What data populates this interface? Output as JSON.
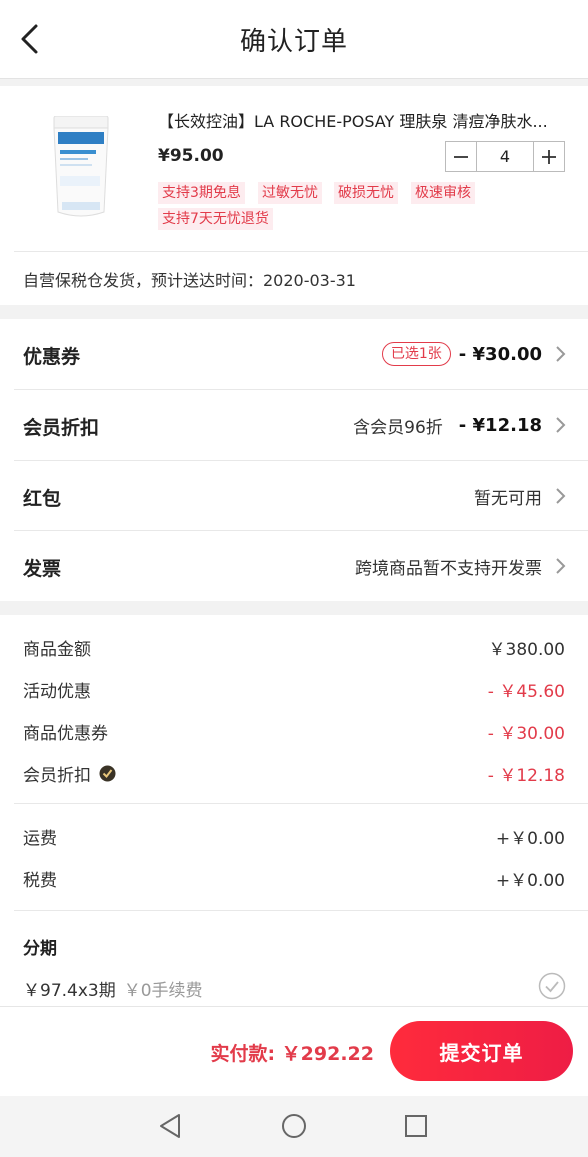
{
  "header": {
    "title": "确认订单"
  },
  "product": {
    "title": "【长效控油】LA ROCHE-POSAY 理肤泉 清痘净肤水...",
    "price": "¥95.00",
    "quantity": "4",
    "tags": [
      "支持3期免息",
      "过敏无忧",
      "破损无忧",
      "极速审核",
      "支持7天无忧退货"
    ],
    "shipping": "自营保税仓发货，预计送达时间：2020-03-31"
  },
  "options": {
    "coupon": {
      "label": "优惠券",
      "badge": "已选1张",
      "amount": "- ¥30.00"
    },
    "member": {
      "label": "会员折扣",
      "note": "含会员96折",
      "amount": "- ¥12.18"
    },
    "redpacket": {
      "label": "红包",
      "value": "暂无可用"
    },
    "invoice": {
      "label": "发票",
      "value": "跨境商品暂不支持开发票"
    }
  },
  "summary": {
    "goods_amount": {
      "label": "商品金额",
      "value": "￥380.00"
    },
    "activity": {
      "label": "活动优惠",
      "value": "- ￥45.60"
    },
    "goods_coupon": {
      "label": "商品优惠券",
      "value": "- ￥30.00"
    },
    "member_discount": {
      "label": "会员折扣",
      "value": "- ￥12.18"
    },
    "freight": {
      "label": "运费",
      "value": "+￥0.00"
    },
    "tax": {
      "label": "税费",
      "value": "+￥0.00"
    }
  },
  "installment": {
    "title": "分期",
    "option": "￥97.4x3期",
    "fee": "￥0手续费"
  },
  "footer": {
    "total": "实付款: ￥292.22",
    "submit": "提交订单"
  },
  "colors": {
    "accent": "#e23b4a",
    "button": "#ff2b3c"
  }
}
